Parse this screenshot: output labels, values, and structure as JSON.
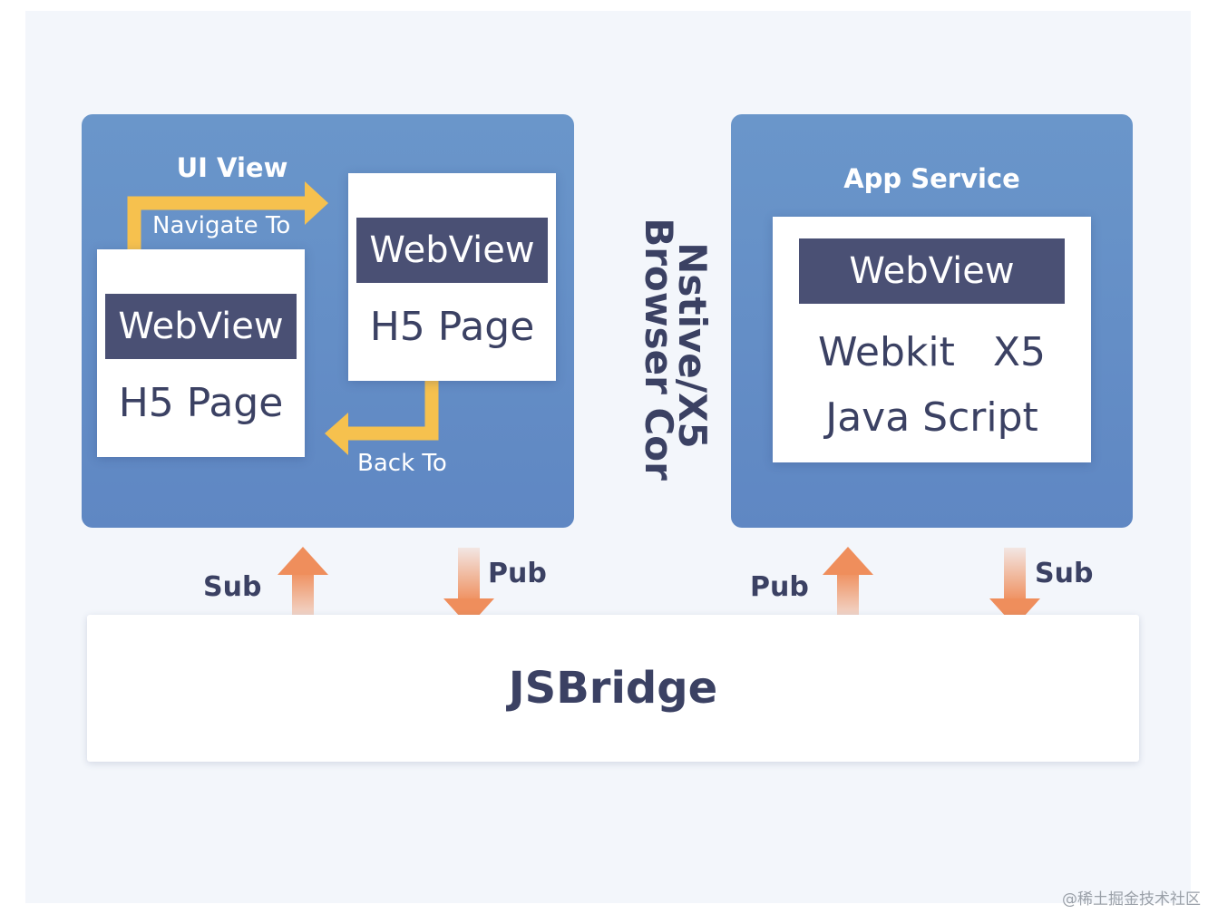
{
  "ui_view": {
    "title": "UI View",
    "navigate_label": "Navigate To",
    "back_label": "Back To",
    "left_card": {
      "webview": "WebView",
      "page": "H5 Page"
    },
    "right_card": {
      "webview": "WebView",
      "page": "H5 Page"
    }
  },
  "core": {
    "line1": "Nstive/X5",
    "line2": "Browser Cor"
  },
  "app_service": {
    "title": "App Service",
    "webview": "WebView",
    "engine": "Webkit   X5",
    "script": "Java Script"
  },
  "pubsub": {
    "left_sub": "Sub",
    "left_pub": "Pub",
    "right_pub": "Pub",
    "right_sub": "Sub"
  },
  "jsbridge": {
    "label": "JSBridge"
  },
  "watermark": "@稀土掘金技术社区",
  "colors": {
    "panel_blue": "#6390c8",
    "webview_bar": "#4a5074",
    "text_dark": "#3b4163",
    "nav_arrow": "#f6c14e",
    "pubsub_arrow": "#ef8e5c"
  }
}
